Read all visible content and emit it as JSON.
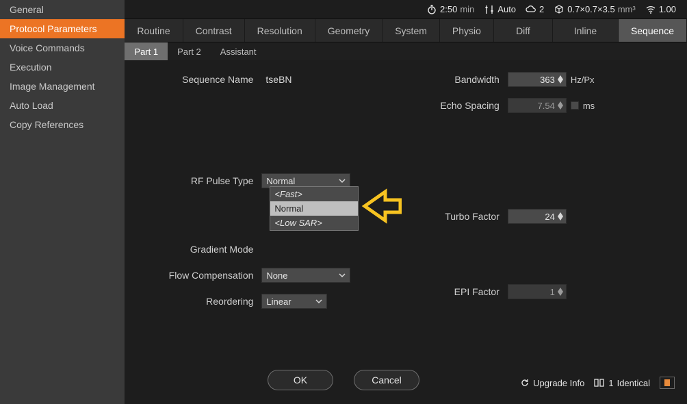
{
  "sidebar": {
    "items": [
      {
        "label": "General"
      },
      {
        "label": "Protocol Parameters"
      },
      {
        "label": "Voice Commands"
      },
      {
        "label": "Execution"
      },
      {
        "label": "Image Management"
      },
      {
        "label": "Auto Load"
      },
      {
        "label": "Copy References"
      }
    ],
    "active_index": 1
  },
  "status": {
    "time_value": "2:50",
    "time_unit": "min",
    "auto_label": "Auto",
    "weight_value": "2",
    "voxel_value": "0.7×0.7×3.5",
    "voxel_unit": "mm³",
    "signal_value": "1.00"
  },
  "tabs": {
    "items": [
      "Routine",
      "Contrast",
      "Resolution",
      "Geometry",
      "System",
      "Physio",
      "Diff",
      "Inline",
      "Sequence"
    ],
    "active_index": 8
  },
  "subtabs": {
    "items": [
      "Part 1",
      "Part 2",
      "Assistant"
    ],
    "active_index": 0
  },
  "left": {
    "sequence_name_label": "Sequence Name",
    "sequence_name_value": "tseBN",
    "rf_pulse_label": "RF Pulse Type",
    "rf_pulse_value": "Normal",
    "rf_pulse_options": [
      "<Fast>",
      "Normal",
      "<Low SAR>"
    ],
    "rf_pulse_hover_index": 1,
    "gradient_mode_label": "Gradient Mode",
    "flow_comp_label": "Flow Compensation",
    "flow_comp_value": "None",
    "reordering_label": "Reordering",
    "reordering_value": "Linear"
  },
  "right": {
    "bandwidth_label": "Bandwidth",
    "bandwidth_value": "363",
    "bandwidth_unit": "Hz/Px",
    "echo_spacing_label": "Echo Spacing",
    "echo_spacing_value": "7.54",
    "echo_spacing_unit": "ms",
    "turbo_factor_label": "Turbo Factor",
    "turbo_factor_value": "24",
    "epi_factor_label": "EPI Factor",
    "epi_factor_value": "1"
  },
  "footer": {
    "ok_label": "OK",
    "cancel_label": "Cancel",
    "upgrade_label": "Upgrade Info",
    "identical_count": "1",
    "identical_label": "Identical"
  },
  "colors": {
    "accent": "#ec7424",
    "annotation": "#f7c321"
  }
}
